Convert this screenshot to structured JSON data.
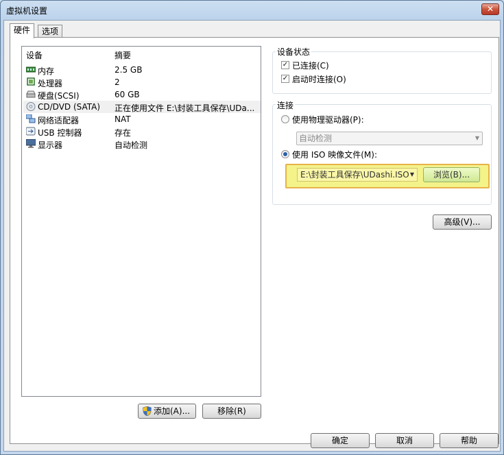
{
  "window": {
    "title": "虚拟机设置",
    "close_label": "✕"
  },
  "tabs": [
    {
      "label": "硬件"
    },
    {
      "label": "选项"
    }
  ],
  "device_list": {
    "headers": {
      "device": "设备",
      "summary": "摘要"
    },
    "rows": [
      {
        "name": "内存",
        "summary": "2.5 GB",
        "icon": "memory-icon"
      },
      {
        "name": "处理器",
        "summary": "2",
        "icon": "processor-icon"
      },
      {
        "name": "硬盘(SCSI)",
        "summary": "60 GB",
        "icon": "hard-disk-icon"
      },
      {
        "name": "CD/DVD (SATA)",
        "summary": "正在使用文件 E:\\封装工具保存\\UDa...",
        "icon": "cd-dvd-icon"
      },
      {
        "name": "网络适配器",
        "summary": "NAT",
        "icon": "network-adapter-icon"
      },
      {
        "name": "USB 控制器",
        "summary": "存在",
        "icon": "usb-icon"
      },
      {
        "name": "显示器",
        "summary": "自动检测",
        "icon": "display-icon"
      }
    ],
    "selected_index": 3
  },
  "buttons": {
    "add": "添加(A)...",
    "remove": "移除(R)",
    "advanced": "高级(V)...",
    "ok": "确定",
    "cancel": "取消",
    "help": "帮助"
  },
  "device_status": {
    "title": "设备状态",
    "connected": {
      "label": "已连接(C)",
      "checked": true
    },
    "connect_at_power_on": {
      "label": "启动时连接(O)",
      "checked": true
    }
  },
  "connection": {
    "title": "连接",
    "physical_drive": {
      "label": "使用物理驱动器(P):",
      "selected": false
    },
    "physical_drive_value": "自动检测",
    "iso_image": {
      "label": "使用 ISO 映像文件(M):",
      "selected": true
    },
    "iso_path": "E:\\封装工具保存\\UDashi.ISO",
    "browse_label": "浏览(B)..."
  },
  "colors": {
    "highlight_fill": "#f3f38a",
    "highlight_border": "#e8b24a"
  }
}
